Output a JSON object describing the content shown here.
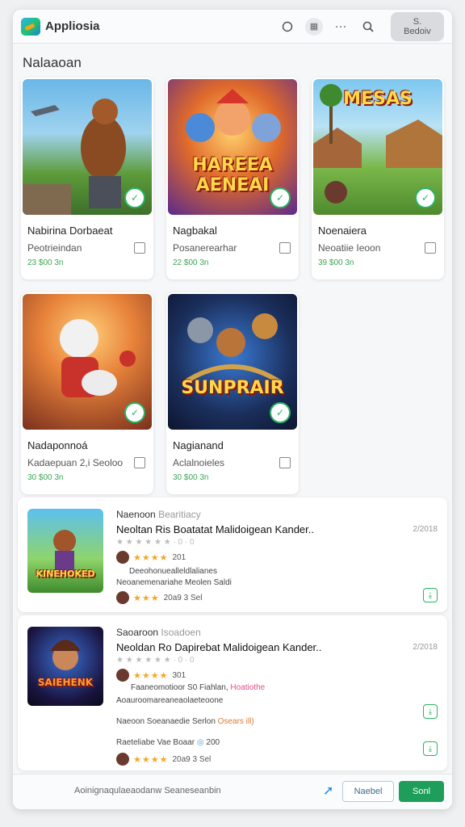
{
  "header": {
    "app_title": "Appliosia",
    "signin_label": "S. Bedoiv",
    "icons": [
      "chat-icon",
      "grid-icon",
      "more-icon",
      "search-icon"
    ]
  },
  "section": {
    "title": "Nalaaoan"
  },
  "cards": [
    {
      "name": "Nabirina Dorbaeat",
      "sub": "Peotrieindan",
      "price": "23 $00 3n",
      "thumb_text": ""
    },
    {
      "name": "Nagbakal",
      "sub": "Posanerearhar",
      "price": "22 $00 3n",
      "thumb_text": "HAREEA AENEAI"
    },
    {
      "name": "Noenaiera",
      "sub": "Neoatiie Ieoon",
      "price": "39 $00 3n",
      "thumb_text": "MESAS"
    },
    {
      "name": "Nadaponnoá",
      "sub": "Kadaepuan 2,i Seoloo",
      "price": "30 $00 3n",
      "thumb_text": ""
    },
    {
      "name": "Nagianand",
      "sub": "Aclalnoieles",
      "price": "30 $00 3n",
      "thumb_text": "SUNPRAIR"
    }
  ],
  "list": [
    {
      "heading": "Naenoon",
      "heading_sub": "Bearitiacy",
      "title": "Neoltan Ris Boatatat Malidoigean Kander..",
      "date": "2/2018",
      "meta": "★ ★ ★ ★ ★ ★ · 0 · 0",
      "rating_text": "201",
      "line1": "Deeohonuealleldlalianes",
      "line2": "Neoanemenariahe Meolen  Saldi",
      "rating2_text": "20a9 3 Sel",
      "thumb_text": "KINEHOKED"
    },
    {
      "heading": "Saoaroon",
      "heading_sub": "Isoadoen",
      "title": "Neoldan Ro Dapirebat Malidoigean Kander..",
      "date": "2/2018",
      "meta": "★ ★ ★ ★ ★ ★ · 0 · 0",
      "rating_text": "301",
      "line1": "Faaneomotioor S0 Fiahlan,",
      "line1_accent": "Hoatiothe",
      "line2": "Aoauroomareaneaolaeteoone",
      "line3": "Naeoon Soeanaedie Serlon",
      "line3_accent": "Osears ill)",
      "line4": "Raeteliabe  Vae Boaar",
      "line4_tail": "200",
      "rating2_text": "20a9 3 Sel",
      "thumb_text": "SAIEHENK"
    }
  ],
  "footer": {
    "hint": "Aoinignaqulaeaodanw Seaneseanbin",
    "next_label": "Naebel",
    "send_label": "Sonl"
  },
  "colors": {
    "accent_green": "#1e9e5a",
    "price_green": "#3aa653",
    "star": "#f5a623"
  }
}
